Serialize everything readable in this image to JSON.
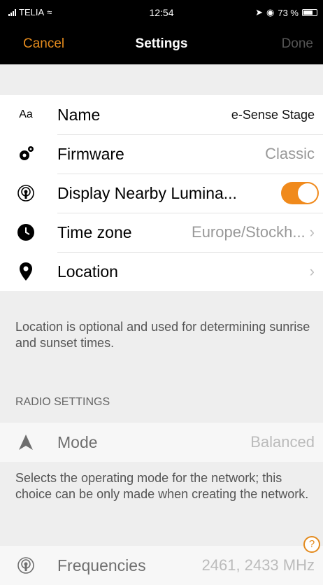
{
  "status": {
    "carrier": "TELIA",
    "time": "12:54",
    "battery": "73 %"
  },
  "nav": {
    "cancel": "Cancel",
    "title": "Settings",
    "done": "Done"
  },
  "settings": {
    "name": {
      "label": "Name",
      "value": "e-Sense Stage",
      "icon": "text-aa-icon",
      "icon_text": "Aa"
    },
    "firmware": {
      "label": "Firmware",
      "value": "Classic",
      "icon": "gears-icon"
    },
    "nearby": {
      "label": "Display Nearby Lumina...",
      "enabled": true,
      "icon": "broadcast-icon"
    },
    "timezone": {
      "label": "Time zone",
      "value": "Europe/Stockh...",
      "icon": "clock-icon"
    },
    "location": {
      "label": "Location",
      "icon": "location-pin-icon"
    }
  },
  "location_note": "Location is optional and used for determining sunrise and sunset times.",
  "radio": {
    "header": "RADIO SETTINGS",
    "mode": {
      "label": "Mode",
      "value": "Balanced",
      "icon": "navigation-arrow-icon"
    },
    "mode_note": "Selects the operating mode for the network; this choice can be only made when creating the network.",
    "frequencies": {
      "label": "Frequencies",
      "value": "2461, 2433 MHz",
      "icon": "broadcast-icon"
    }
  },
  "help": "?",
  "colors": {
    "accent": "#e38a1d",
    "toggle": "#f08a1c"
  }
}
